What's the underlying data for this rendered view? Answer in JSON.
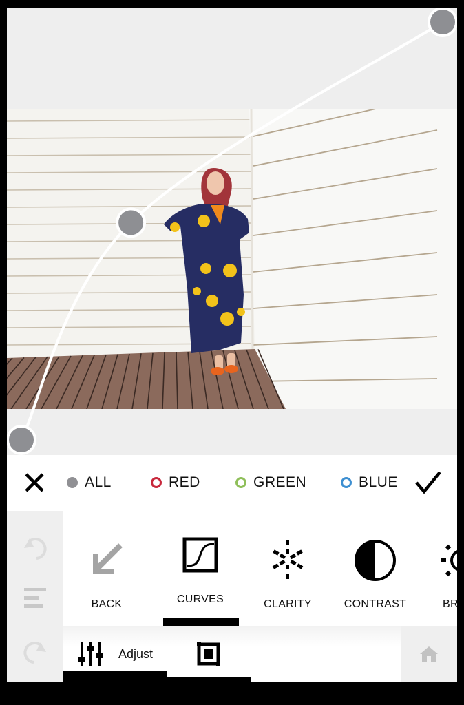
{
  "curve": {
    "channel": "ALL",
    "points": [
      {
        "in": 0,
        "out": 0
      },
      {
        "in": 0.26,
        "out": 0.52
      },
      {
        "in": 1,
        "out": 1
      }
    ],
    "point_color": "#8e8f93",
    "line_color": "#ffffff"
  },
  "photo": {
    "description": "Woman in navy floral wrap dress with orange shoes standing on a wooden deck in front of white weatherboard walls"
  },
  "channel_bar": {
    "close_icon": "close-x-icon",
    "apply_icon": "checkmark-icon",
    "channels": [
      {
        "label": "ALL",
        "color": "#909094",
        "selected": true
      },
      {
        "label": "RED",
        "color": "#c8283c",
        "selected": false
      },
      {
        "label": "GREEN",
        "color": "#8fbf5a",
        "selected": false
      },
      {
        "label": "BLUE",
        "color": "#3d8fd1",
        "selected": false
      }
    ]
  },
  "sidebar": {
    "undo_icon": "undo-icon",
    "menu_icon": "menu-lines-icon",
    "redo_icon": "redo-icon"
  },
  "tools": {
    "active": "CURVES",
    "items": [
      {
        "label": "BACK",
        "icon": "back-arrow-icon"
      },
      {
        "label": "CURVES",
        "icon": "curves-icon"
      },
      {
        "label": "CLARITY",
        "icon": "clarity-icon"
      },
      {
        "label": "CONTRAST",
        "icon": "contrast-icon"
      },
      {
        "label": "BRIGHTNESS",
        "visible_label": "BRIG",
        "icon": "brightness-icon"
      }
    ]
  },
  "tabbar": {
    "tabs": [
      {
        "label": "Adjust",
        "icon": "sliders-icon",
        "active": true
      },
      {
        "label": "",
        "icon": "crop-icon",
        "active": false
      }
    ],
    "home_icon": "home-icon"
  }
}
